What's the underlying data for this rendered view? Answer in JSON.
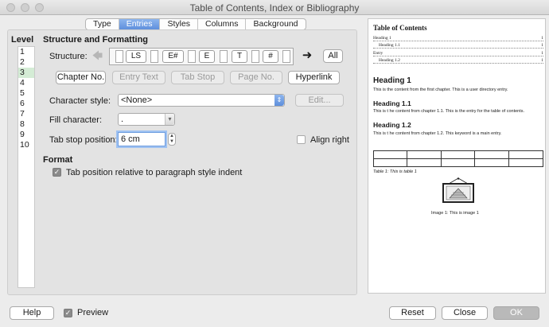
{
  "window": {
    "title": "Table of Contents, Index or Bibliography"
  },
  "tabs": [
    "Type",
    "Entries",
    "Styles",
    "Columns",
    "Background"
  ],
  "level": {
    "label": "Level",
    "items": [
      "1",
      "2",
      "3",
      "4",
      "5",
      "6",
      "7",
      "8",
      "9",
      "10"
    ],
    "selected_index": 2
  },
  "structure": {
    "heading": "Structure and Formatting",
    "label": "Structure:",
    "tokens": [
      "LS",
      "E#",
      "E",
      "T",
      "#"
    ],
    "all_button": "All",
    "insert_buttons": [
      "Chapter No.",
      "Entry Text",
      "Tab Stop",
      "Page No.",
      "Hyperlink"
    ]
  },
  "character_style": {
    "label": "Character style:",
    "value": "<None>",
    "edit_button": "Edit..."
  },
  "fill_character": {
    "label": "Fill character:",
    "value": "."
  },
  "tab_stop": {
    "label": "Tab stop position:",
    "value": "6 cm",
    "align_right_label": "Align right",
    "align_right_checked": false
  },
  "format": {
    "heading": "Format",
    "relative_label": "Tab position relative to paragraph style indent",
    "relative_checked": true
  },
  "preview_doc": {
    "toc_title": "Table of Contents",
    "toc_entries": [
      {
        "text": "Heading 1",
        "page": "1",
        "indent": 0
      },
      {
        "text": "Heading 1.1",
        "page": "1",
        "indent": 1
      },
      {
        "text": "Entry",
        "page": "1",
        "indent": 0
      },
      {
        "text": "Heading 1.2",
        "page": "1",
        "indent": 1
      }
    ],
    "h1": "Heading 1",
    "p1": "This is  the content from the first chapter. This is a user directory entry.",
    "h11": "Heading 1.1",
    "p11": "This is t he content from chapter 1.1. This is the entry for the table of contents.",
    "h12": "Heading 1.2",
    "p12": "This is t he content from chapter 1.2. This keyword is a main entry.",
    "table_caption": "Table 1: This is table 1",
    "image_caption": "Image 1: This is image 1"
  },
  "footer": {
    "help": "Help",
    "preview_label": "Preview",
    "preview_checked": true,
    "reset": "Reset",
    "close": "Close",
    "ok": "OK"
  }
}
